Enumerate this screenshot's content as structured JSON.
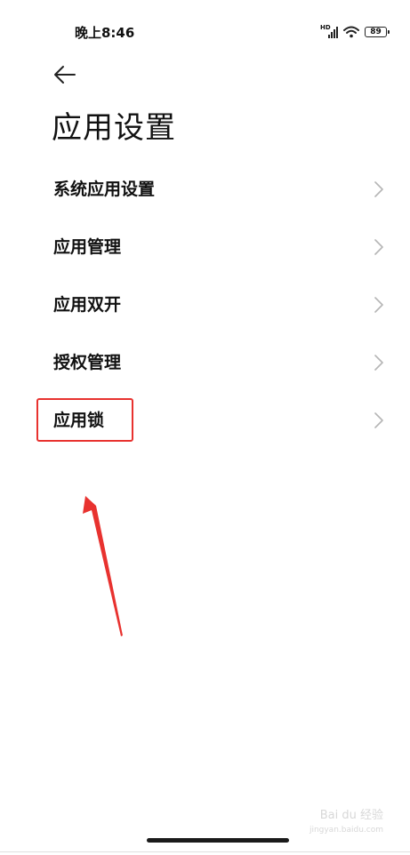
{
  "status_bar": {
    "time": "晚上8:46",
    "network_label": "HD",
    "battery": "89"
  },
  "header": {
    "back_icon": "arrow-left-icon",
    "title": "应用设置"
  },
  "menu": {
    "items": [
      {
        "label": "系统应用设置",
        "icon": "chevron-right-icon"
      },
      {
        "label": "应用管理",
        "icon": "chevron-right-icon"
      },
      {
        "label": "应用双开",
        "icon": "chevron-right-icon"
      },
      {
        "label": "授权管理",
        "icon": "chevron-right-icon"
      },
      {
        "label": "应用锁",
        "icon": "chevron-right-icon"
      }
    ]
  },
  "annotation": {
    "color": "#e8322f"
  },
  "watermark": {
    "brand": "Bai du 经验",
    "url": "jingyan.baidu.com"
  }
}
